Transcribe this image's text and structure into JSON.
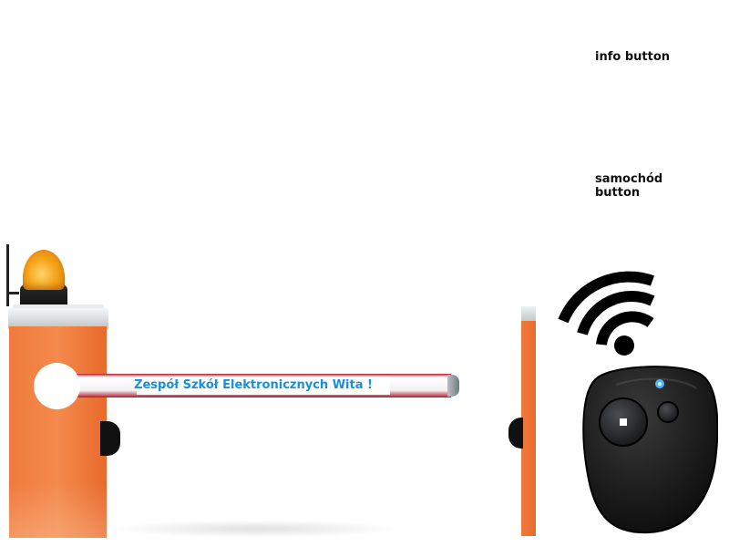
{
  "buttons": {
    "info_label": "info button",
    "car_label": "samochód button"
  },
  "barrier": {
    "arm_text": "Zespół Szkół Elektronicznych Wita !"
  },
  "icons": {
    "lamp": "warning-lamp-icon",
    "remote": "remote-control-icon",
    "signal": "wifi-signal-icon"
  },
  "colors": {
    "gate_orange": "#f07a3e",
    "arm_text": "#1b8fd6",
    "arm_stripe": "#b4182a",
    "lamp_amber": "#f5a318",
    "remote_body": "#1c1c1c"
  }
}
